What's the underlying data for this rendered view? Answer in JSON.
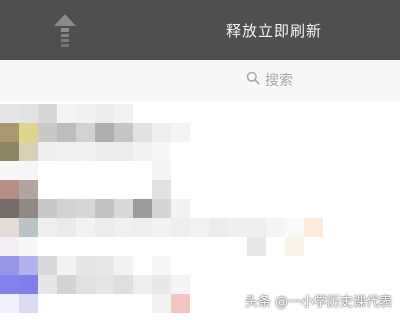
{
  "header": {
    "pull_text": "释放立即刷新",
    "arrow_icon": "up-arrow-icon"
  },
  "search": {
    "placeholder": "搜索",
    "icon": "search-icon"
  },
  "list": {
    "pixelated": true,
    "rows": [
      [
        "#e6e6e6",
        "#e3e3e3",
        "#d8d8d8",
        "#f4f4f4",
        "#f1f1f1",
        "#ededed",
        "#f2f2f2",
        "#ffffff",
        "#ffffff",
        "#ffffff",
        "#ffffff",
        "#ffffff",
        "#ffffff",
        "#ffffff",
        "#ffffff",
        "#ffffff",
        "#ffffff",
        "#ffffff",
        "#ffffff",
        "#ffffff",
        "#ffffff"
      ],
      [
        "#a89a6e",
        "#ded58c",
        "#c9c9c9",
        "#bdbdbd",
        "#d2d2d2",
        "#aeaeae",
        "#c6c6c6",
        "#e2e2e2",
        "#eeeeee",
        "#f4f4f4",
        "#ffffff",
        "#ffffff",
        "#ffffff",
        "#ffffff",
        "#ffffff",
        "#ffffff",
        "#ffffff",
        "#ffffff",
        "#ffffff",
        "#ffffff",
        "#ffffff"
      ],
      [
        "#8e8562",
        "#d6d2b8",
        "#eeeeee",
        "#f0f0f0",
        "#f1f1f1",
        "#ededed",
        "#ececec",
        "#f3f3f3",
        "#f8f8f8",
        "#ffffff",
        "#ffffff",
        "#ffffff",
        "#ffffff",
        "#ffffff",
        "#ffffff",
        "#ffffff",
        "#ffffff",
        "#ffffff",
        "#ffffff",
        "#ffffff",
        "#ffffff"
      ],
      [
        "#f6f6f6",
        "#f6f6f6",
        "#ffffff",
        "#ffffff",
        "#ffffff",
        "#ffffff",
        "#ffffff",
        "#ffffff",
        "#f4f4f4",
        "#ffffff",
        "#ffffff",
        "#ffffff",
        "#ffffff",
        "#ffffff",
        "#ffffff",
        "#ffffff",
        "#ffffff",
        "#ffffff",
        "#ffffff",
        "#ffffff",
        "#ffffff"
      ],
      [
        "#b48f82",
        "#b5a5a2",
        "#ffffff",
        "#ffffff",
        "#ffffff",
        "#ffffff",
        "#ffffff",
        "#ffffff",
        "#e2e2e2",
        "#ffffff",
        "#ffffff",
        "#ffffff",
        "#ffffff",
        "#ffffff",
        "#ffffff",
        "#ffffff",
        "#ffffff",
        "#ffffff",
        "#ffffff",
        "#ffffff",
        "#ffffff"
      ],
      [
        "#756c69",
        "#8f8885",
        "#c9c9c9",
        "#d3d3d3",
        "#d7d7d7",
        "#c2c2c2",
        "#d9d9d9",
        "#9b9b9b",
        "#d6d6d6",
        "#f2f2f2",
        "#ffffff",
        "#ffffff",
        "#ffffff",
        "#ffffff",
        "#ffffff",
        "#ffffff",
        "#ffffff",
        "#ffffff",
        "#ffffff",
        "#ffffff",
        "#ffffff"
      ],
      [
        "#e5dcd8",
        "#b9c3c6",
        "#efefef",
        "#eaeaea",
        "#f2f2f2",
        "#ececec",
        "#f0f0f0",
        "#eeeeee",
        "#f2f2f2",
        "#eeeeee",
        "#f2f2f2",
        "#ececec",
        "#efefef",
        "#eeeeee",
        "#f5f5f5",
        "#f9f9f9",
        "#fcebd8",
        "#ffffff",
        "#ffffff",
        "#ffffff",
        "#ffffff"
      ],
      [
        "#f4eef4",
        "#f8f8f8",
        "#ffffff",
        "#ffffff",
        "#ffffff",
        "#ffffff",
        "#ffffff",
        "#ffffff",
        "#ffffff",
        "#ffffff",
        "#ffffff",
        "#ffffff",
        "#ffffff",
        "#e8e8e8",
        "#ffffff",
        "#fbf4e8",
        "#ffffff",
        "#ffffff",
        "#ffffff",
        "#ffffff",
        "#ffffff"
      ],
      [
        "#9696e8",
        "#b2b2ee",
        "#d9d9d9",
        "#f2f2f2",
        "#e6e6e6",
        "#e9e9e9",
        "#f3f3f3",
        "#ffffff",
        "#f7f7f7",
        "#ffffff",
        "#ffffff",
        "#ffffff",
        "#ffffff",
        "#ffffff",
        "#ffffff",
        "#ffffff",
        "#ffffff",
        "#ffffff",
        "#ffffff",
        "#ffffff",
        "#ffffff"
      ],
      [
        "#8282ec",
        "#7f7fe8",
        "#e7e7e7",
        "#d3d3d3",
        "#e1e1e1",
        "#e5e5e5",
        "#dfdfdf",
        "#eeeeee",
        "#e9e9e9",
        "#f4f4f4",
        "#ffffff",
        "#ffffff",
        "#ffffff",
        "#ffffff",
        "#ffffff",
        "#ffffff",
        "#ffffff",
        "#ffffff",
        "#ffffff",
        "#ffffff",
        "#ffffff"
      ],
      [
        "#f1f1ff",
        "#dadaf7",
        "#ffffff",
        "#ffffff",
        "#ffffff",
        "#ffffff",
        "#ffffff",
        "#ffffff",
        "#f2f2f2",
        "#f4c4c0",
        "#ffffff",
        "#ffffff",
        "#ffffff",
        "#ffffff",
        "#ffffff",
        "#ffffff",
        "#ffffff",
        "#ffffff",
        "#ffffff",
        "#ffffff",
        "#ffffff"
      ]
    ]
  },
  "watermark": {
    "text": "头条 @一小学历史课代表"
  }
}
